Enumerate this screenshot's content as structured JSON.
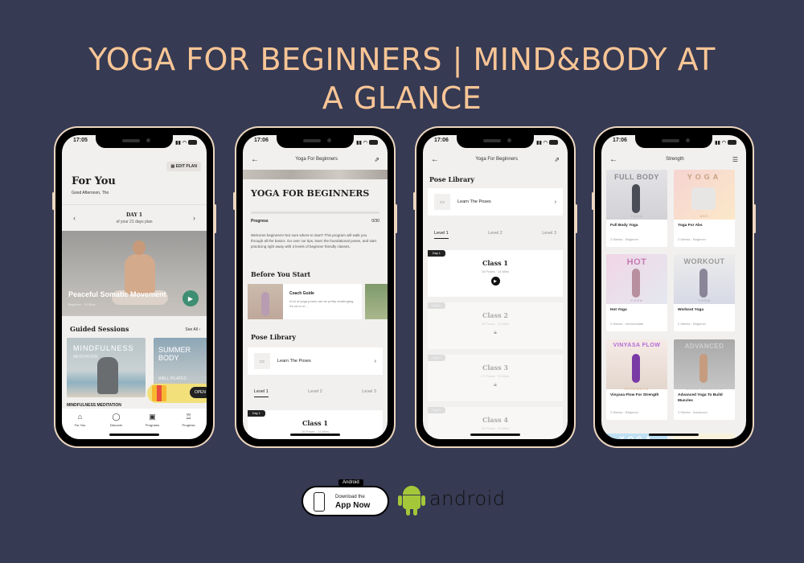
{
  "headline": {
    "line1": "YOGA FOR BEGINNERS | MIND&BODY AT",
    "line2": "A GLANCE"
  },
  "colors": {
    "background": "#363a52",
    "headline": "#f8c596",
    "accent_green": "#3e8e73",
    "android_green": "#a4c639"
  },
  "phones": [
    {
      "time": "17:05",
      "battery": "44",
      "edit_plan": "EDIT PLAN",
      "title": "For You",
      "greeting": "Good Afternoon, Tho",
      "day_title": "DAY 1",
      "day_sub": "of your 21 days plan",
      "hero": {
        "title": "Peaceful Somatic Movement",
        "sub": "Beginner · 13 Mins"
      },
      "guided": {
        "title": "Guided Sessions",
        "see_all": "See All ›"
      },
      "cards": [
        {
          "big": "MINDFULNESS",
          "small": "MEDITATION",
          "label": "MINDFULNESS MEDITATION"
        },
        {
          "big1": "SUMMER",
          "big2": "BODY",
          "small": "WALL PILATES"
        }
      ],
      "gift_button": "OPEN",
      "tabs": [
        {
          "icon": "home-icon",
          "glyph": "⌂",
          "label": "For You"
        },
        {
          "icon": "search-icon",
          "glyph": "◯",
          "label": "Discover"
        },
        {
          "icon": "programs-icon",
          "glyph": "▣",
          "label": "Programs"
        },
        {
          "icon": "trophy-icon",
          "glyph": "♖",
          "label": "Progress"
        }
      ]
    },
    {
      "time": "17:06",
      "battery": "44",
      "nav_title": "Yoga For Beginners",
      "title": "YOGA FOR BEGINNERS",
      "progress_label": "Progress",
      "progress_value": "0/30",
      "progress_fraction": 0,
      "description": "Welcome beginners! Not sure where to start? This program will walk you through all the basics. Go over our tips, learn the foundational poses, and start practicing right away with 3 levels of beginner friendly classes.",
      "before_title": "Before You Start",
      "coach": {
        "title": "Coach Guide",
        "desc": "A lot of yoga poses can be pretty challenging. It's ok to re..."
      },
      "pose_library": "Pose Library",
      "learn_poses": "Learn The Poses",
      "levels": [
        "Level 1",
        "Level 2",
        "Level 3"
      ],
      "class1": {
        "day": "Day 1",
        "title": "Class 1",
        "sub": "16 Poses · 14 Mins"
      }
    },
    {
      "time": "17:06",
      "battery": "44",
      "nav_title": "Yoga For Beginners",
      "pose_library": "Pose Library",
      "learn_poses": "Learn The Poses",
      "levels": [
        "Level 1",
        "Level 2",
        "Level 3"
      ],
      "classes": [
        {
          "day": "Day 1",
          "title": "Class 1",
          "sub": "16 Poses · 14 Mins",
          "locked": false
        },
        {
          "day": "Day 2",
          "title": "Class 2",
          "sub": "16 Poses · 14 Mins",
          "locked": true
        },
        {
          "day": "Day 3",
          "title": "Class 3",
          "sub": "17 Poses · 15 Mins",
          "locked": true
        },
        {
          "day": "Day 4",
          "title": "Class 4",
          "sub": "15 Poses · 13 Mins",
          "locked": true
        }
      ]
    },
    {
      "time": "17:06",
      "battery": "44",
      "nav_title": "Strength",
      "programs": [
        {
          "big": "FULL BODY",
          "small": "YOGA",
          "title": "Full Body Yoga",
          "sub": "2 Weeks · Beginner"
        },
        {
          "big": "YOGA",
          "small": "ABS",
          "title": "Yoga For Abs",
          "sub": "2 Weeks · Beginner"
        },
        {
          "big": "HOT",
          "small": "YOGA",
          "title": "Hot Yoga",
          "sub": "2 Weeks · Intermediate"
        },
        {
          "big": "WORKOUT",
          "small": "YOGA",
          "title": "Workout Yoga",
          "sub": "2 Weeks · Beginner"
        },
        {
          "big": "VINYASA FLOW",
          "small": "STRENGTH",
          "title": "Vinyasa Flow For Strength",
          "sub": "2 Weeks · Beginner"
        },
        {
          "big": "ADVANCED",
          "small": "BUILD MUSCLES",
          "title": "Advanced Yoga To Build Muscles",
          "sub": "3 Weeks · Advanced"
        }
      ],
      "peek_label": "YOGA"
    }
  ],
  "badges": {
    "tag": "Android",
    "line1": "Download the",
    "line2": "App Now",
    "brand": "android"
  }
}
